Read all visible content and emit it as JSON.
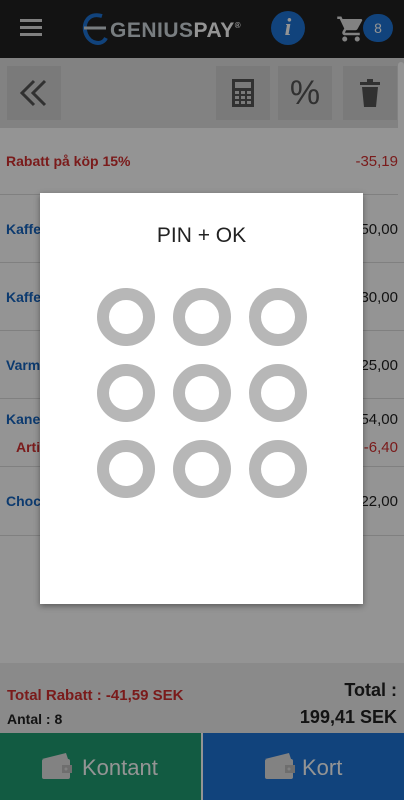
{
  "header": {
    "logo_genius": "GENIUS",
    "logo_pay": "PAY",
    "logo_reg": "®",
    "info_label": "i",
    "cart_count": "8"
  },
  "toolbar": {
    "percent_label": "%"
  },
  "items": [
    {
      "name": "Rabatt på köp 15%",
      "price": "-35,19",
      "kind": "discount"
    },
    {
      "name": "Kaffe",
      "price": "50,00",
      "kind": "product"
    },
    {
      "name": "Kaffe",
      "price": "30,00",
      "kind": "product"
    },
    {
      "name": "Varm",
      "price": "25,00",
      "kind": "product"
    },
    {
      "name": "Kane",
      "price": "54,00",
      "kind": "product"
    },
    {
      "name": "Arti",
      "price": "-6,40",
      "kind": "sub"
    },
    {
      "name": "Choc",
      "price": "22,00",
      "kind": "product"
    }
  ],
  "summary": {
    "total_rabatt": "Total Rabatt : -41,59 SEK",
    "antal": "Antal : 8",
    "total_label": "Total :",
    "total_value": "199,41 SEK"
  },
  "payment": {
    "cash_label": "Kontant",
    "card_label": "Kort"
  },
  "dialog": {
    "title": "PIN + OK",
    "pin_dots": 9
  },
  "colors": {
    "topbar": "#212121",
    "accent_blue": "#1e74d6",
    "cash_green": "#1f9e72",
    "discount_red": "#d32f2f",
    "product_blue": "#1565c0"
  }
}
